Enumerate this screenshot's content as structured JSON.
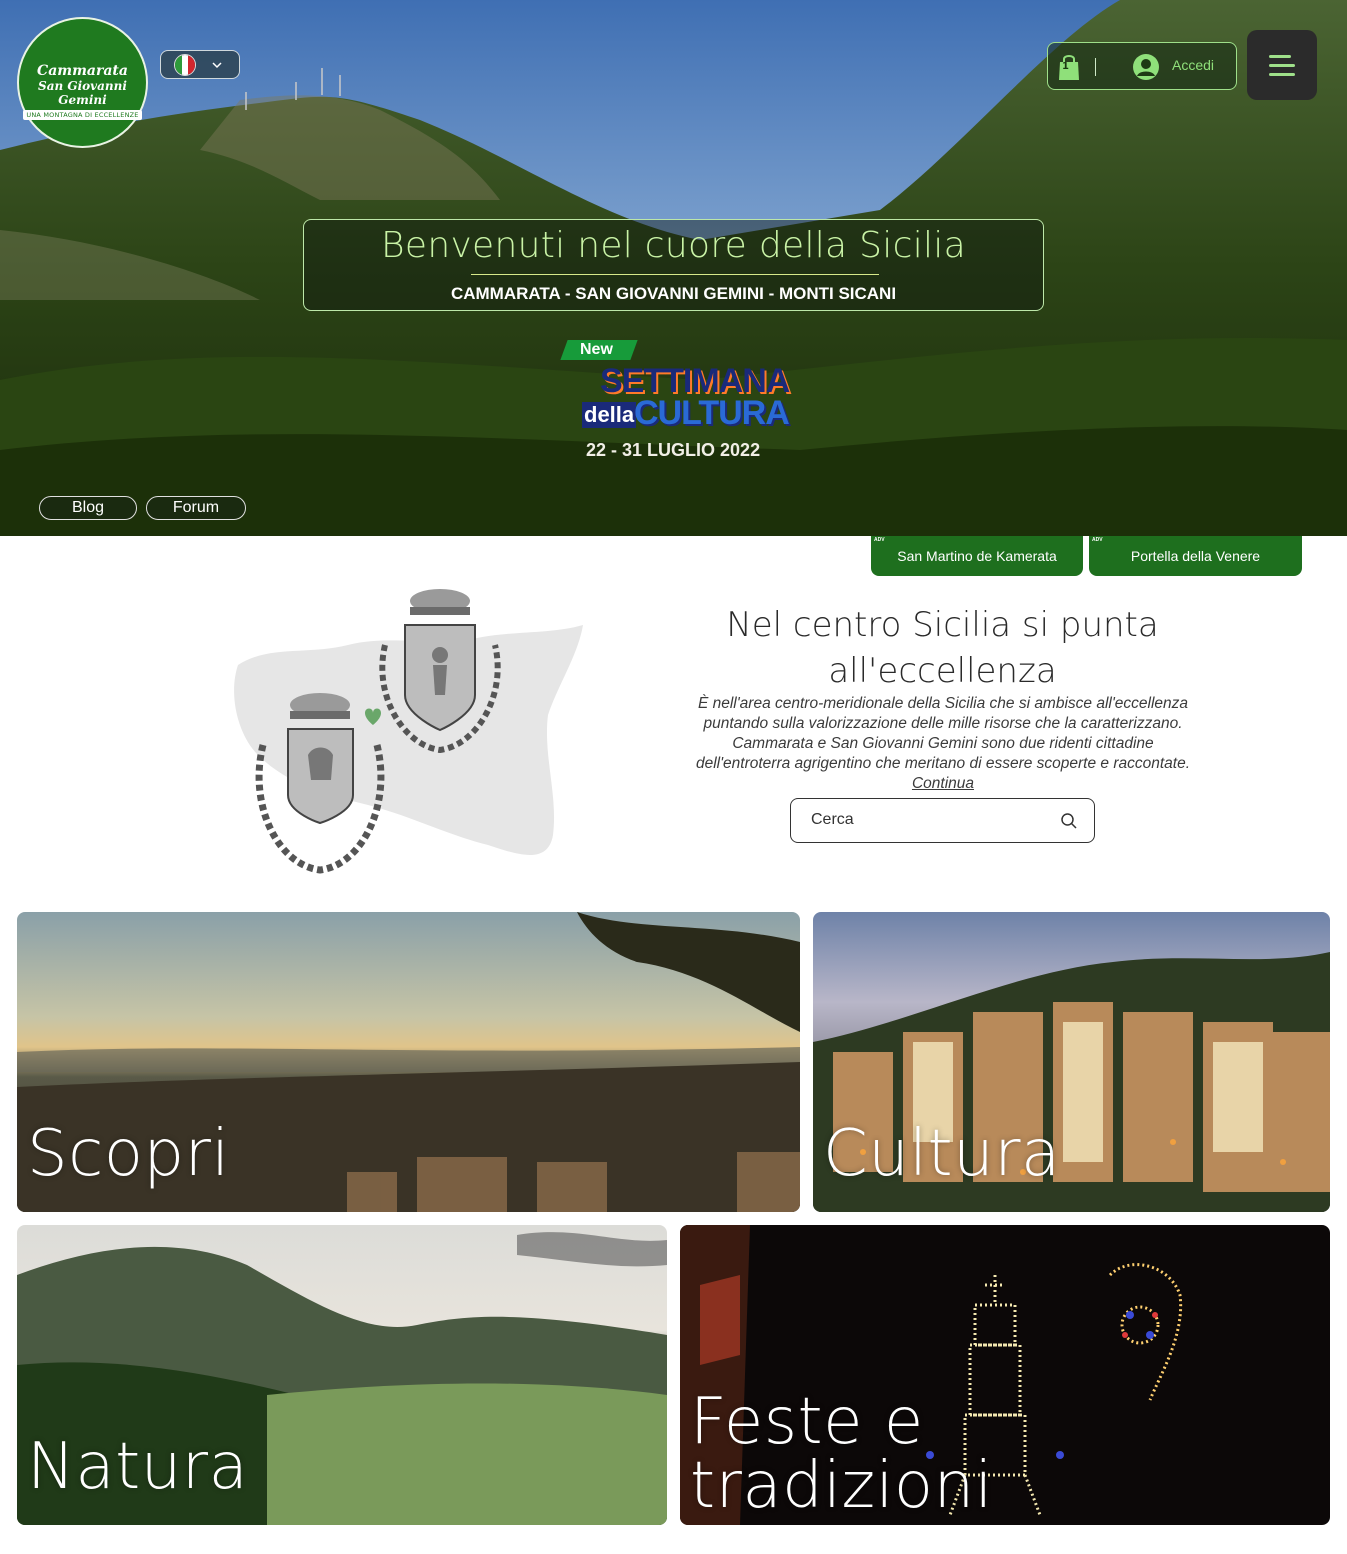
{
  "header": {
    "logo": {
      "line1": "Cammarata",
      "line2": "San Giovanni Gemini",
      "tagline": "UNA MONTAGNA DI ECCELLENZE"
    },
    "language": {
      "flag_icon": "italy-flag-icon",
      "colors": [
        "#2e9a3a",
        "#ffffff",
        "#d2262e"
      ]
    },
    "cart": {
      "count": "1"
    },
    "login_label": "Accedi"
  },
  "hero": {
    "title": "Benvenuti nel cuore della Sicilia",
    "subtitle": "CAMMARATA - SAN GIOVANNI GEMINI - MONTI SICANI",
    "event": {
      "new_label": "New",
      "line1": "SETTIMANA",
      "line2a": "della",
      "line2b": "CULTURA",
      "date": "22 - 31 LUGLIO 2022"
    },
    "pills": [
      {
        "label": "Blog"
      },
      {
        "label": "Forum"
      }
    ]
  },
  "adv_tabs": [
    {
      "tag": "ADV",
      "label": "San Martino de Kamerata"
    },
    {
      "tag": "ADV",
      "label": "Portella della Venere"
    }
  ],
  "intro": {
    "title_line1": "Nel centro Sicilia si punta",
    "title_line2": "all'eccellenza",
    "text": "È nell'area centro-meridionale della Sicilia che si ambisce all'eccellenza puntando sulla valorizzazione delle mille risorse che la caratterizzano. Cammarata e San Giovanni Gemini sono due ridenti cittadine dell'entroterra agrigentino che meritano di essere scoperte e raccontate.",
    "link": "Continua"
  },
  "search": {
    "placeholder": "Cerca"
  },
  "cards": [
    {
      "label": "Scopri"
    },
    {
      "label": "Cultura"
    },
    {
      "label": "Natura"
    },
    {
      "label_line1": "Feste e",
      "label_line2": "tradizioni"
    }
  ],
  "colors": {
    "brand_green": "#1e6f1e",
    "accent_light_green": "#9fe08a"
  }
}
